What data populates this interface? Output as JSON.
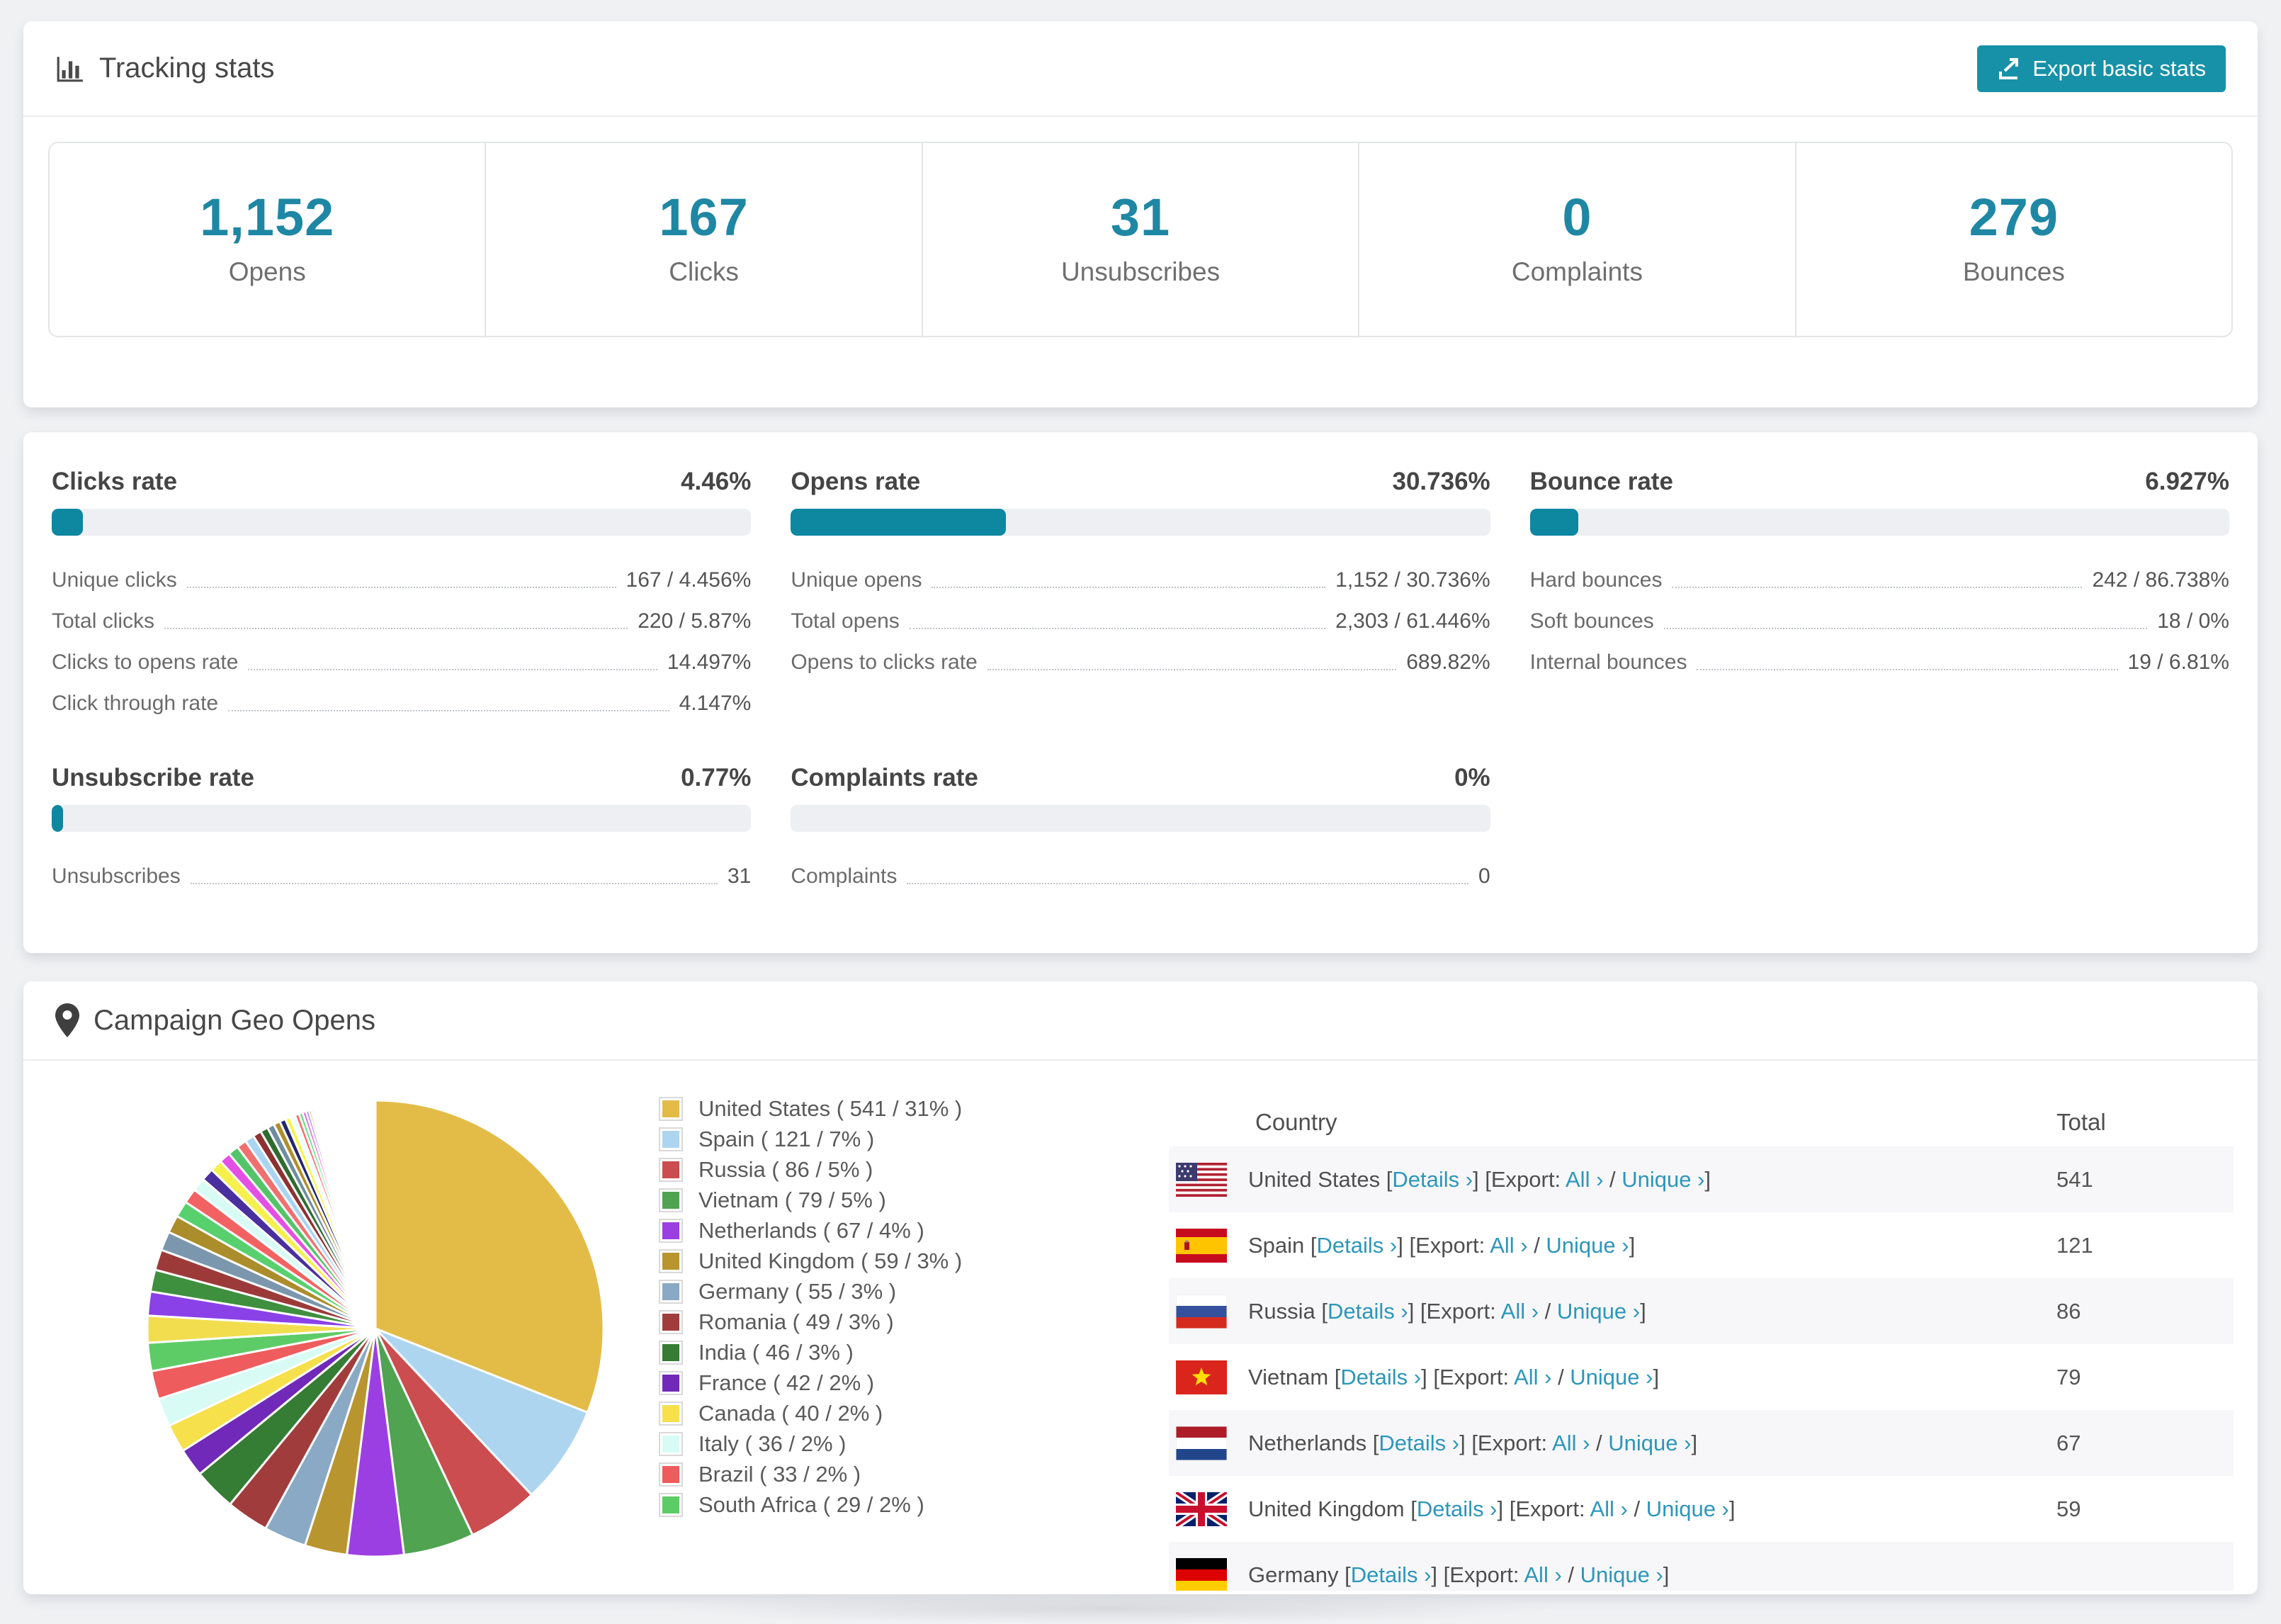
{
  "header": {
    "title": "Tracking stats",
    "export_button": "Export basic stats"
  },
  "summary_stats": [
    {
      "value": "1,152",
      "label": "Opens"
    },
    {
      "value": "167",
      "label": "Clicks"
    },
    {
      "value": "31",
      "label": "Unsubscribes"
    },
    {
      "value": "0",
      "label": "Complaints"
    },
    {
      "value": "279",
      "label": "Bounces"
    }
  ],
  "rate_cards": [
    {
      "title": "Clicks rate",
      "value_label": "4.46%",
      "percent": 4.46,
      "rows": [
        {
          "label": "Unique clicks",
          "value": "167 / 4.456%"
        },
        {
          "label": "Total clicks",
          "value": "220 / 5.87%"
        },
        {
          "label": "Clicks to opens rate",
          "value": "14.497%"
        },
        {
          "label": "Click through rate",
          "value": "4.147%"
        }
      ]
    },
    {
      "title": "Opens rate",
      "value_label": "30.736%",
      "percent": 30.736,
      "rows": [
        {
          "label": "Unique opens",
          "value": "1,152 / 30.736%"
        },
        {
          "label": "Total opens",
          "value": "2,303 / 61.446%"
        },
        {
          "label": "Opens to clicks rate",
          "value": "689.82%"
        }
      ]
    },
    {
      "title": "Bounce rate",
      "value_label": "6.927%",
      "percent": 6.927,
      "rows": [
        {
          "label": "Hard bounces",
          "value": "242 / 86.738%"
        },
        {
          "label": "Soft bounces",
          "value": "18 / 0%"
        },
        {
          "label": "Internal bounces",
          "value": "19 / 6.81%"
        }
      ]
    },
    {
      "title": "Unsubscribe rate",
      "value_label": "0.77%",
      "percent": 0.77,
      "rows": [
        {
          "label": "Unsubscribes",
          "value": "31"
        }
      ]
    },
    {
      "title": "Complaints rate",
      "value_label": "0%",
      "percent": 0,
      "rows": [
        {
          "label": "Complaints",
          "value": "0"
        }
      ]
    }
  ],
  "geo": {
    "title": "Campaign Geo Opens",
    "links": {
      "details": "Details ›",
      "all": "All ›",
      "unique": "Unique ›"
    },
    "row_parts": {
      "p1": " [",
      "p2": "] [Export: ",
      "p3": " / ",
      "p4": "]"
    },
    "table": {
      "columns": [
        "Country",
        "Total"
      ],
      "rows": [
        {
          "flag": "us",
          "country": "United States",
          "total": "541"
        },
        {
          "flag": "es",
          "country": "Spain",
          "total": "121"
        },
        {
          "flag": "ru",
          "country": "Russia",
          "total": "86"
        },
        {
          "flag": "vn",
          "country": "Vietnam",
          "total": "79"
        },
        {
          "flag": "nl",
          "country": "Netherlands",
          "total": "67"
        },
        {
          "flag": "gb",
          "country": "United Kingdom",
          "total": "59"
        },
        {
          "flag": "de",
          "country": "Germany",
          "total": ""
        }
      ]
    }
  },
  "chart_data": {
    "type": "pie",
    "title": "Campaign Geo Opens",
    "legend_position": "right",
    "slices": [
      {
        "name": "United States",
        "value": 541,
        "pct": 31,
        "color": "#e3bc48",
        "label": "United States ( 541 / 31% )"
      },
      {
        "name": "Spain",
        "value": 121,
        "pct": 7,
        "color": "#aed5f0",
        "label": "Spain ( 121 / 7% )"
      },
      {
        "name": "Russia",
        "value": 86,
        "pct": 5,
        "color": "#cb4d4f",
        "label": "Russia ( 86 / 5% )"
      },
      {
        "name": "Vietnam",
        "value": 79,
        "pct": 5,
        "color": "#4fa351",
        "label": "Vietnam ( 79 / 5% )"
      },
      {
        "name": "Netherlands",
        "value": 67,
        "pct": 4,
        "color": "#9b3fe3",
        "label": "Netherlands ( 67 / 4% )"
      },
      {
        "name": "United Kingdom",
        "value": 59,
        "pct": 3,
        "color": "#b9952f",
        "label": "United Kingdom ( 59 / 3% )"
      },
      {
        "name": "Germany",
        "value": 55,
        "pct": 3,
        "color": "#8aa9c4",
        "label": "Germany ( 55 / 3% )"
      },
      {
        "name": "Romania",
        "value": 49,
        "pct": 3,
        "color": "#a03d3c",
        "label": "Romania ( 49 / 3% )"
      },
      {
        "name": "India",
        "value": 46,
        "pct": 3,
        "color": "#357c35",
        "label": "India ( 46 / 3% )"
      },
      {
        "name": "France",
        "value": 42,
        "pct": 2,
        "color": "#7029b8",
        "label": "France ( 42 / 2% )"
      },
      {
        "name": "Canada",
        "value": 40,
        "pct": 2,
        "color": "#f6e04b",
        "label": "Canada ( 40 / 2% )"
      },
      {
        "name": "Italy",
        "value": 36,
        "pct": 2,
        "color": "#d8fbf5",
        "label": "Italy ( 36 / 2% )"
      },
      {
        "name": "Brazil",
        "value": 33,
        "pct": 2,
        "color": "#ef5c5e",
        "label": "Brazil ( 33 / 2% )"
      },
      {
        "name": "South Africa",
        "value": 29,
        "pct": 2,
        "color": "#5ecc66",
        "label": "South Africa ( 29 / 2% )"
      }
    ],
    "other_slices": [
      {
        "pct": 1.9,
        "color": "#f2dd4e"
      },
      {
        "pct": 1.7,
        "color": "#8a41e8"
      },
      {
        "pct": 1.55,
        "color": "#3e8f3e"
      },
      {
        "pct": 1.45,
        "color": "#9c3a3a"
      },
      {
        "pct": 1.35,
        "color": "#7b97ad"
      },
      {
        "pct": 1.25,
        "color": "#ab8d2c"
      },
      {
        "pct": 1.15,
        "color": "#58d06e"
      },
      {
        "pct": 1.05,
        "color": "#f26262"
      },
      {
        "pct": 0.95,
        "color": "#d9fbf6"
      },
      {
        "pct": 0.9,
        "color": "#4a2f9e"
      },
      {
        "pct": 0.85,
        "color": "#f5f04e"
      },
      {
        "pct": 0.8,
        "color": "#e44fe4"
      },
      {
        "pct": 0.75,
        "color": "#54c468"
      },
      {
        "pct": 0.7,
        "color": "#f07070"
      },
      {
        "pct": 0.65,
        "color": "#a9d4f2"
      },
      {
        "pct": 0.6,
        "color": "#8d3131"
      },
      {
        "pct": 0.55,
        "color": "#2f6b2f"
      },
      {
        "pct": 0.5,
        "color": "#6f8da1"
      },
      {
        "pct": 0.46,
        "color": "#b08e2b"
      },
      {
        "pct": 0.42,
        "color": "#26266b"
      },
      {
        "pct": 0.38,
        "color": "#f7f44f"
      },
      {
        "pct": 0.34,
        "color": "#e8fffd"
      },
      {
        "pct": 0.3,
        "color": "#fb6b6b"
      },
      {
        "pct": 0.27,
        "color": "#64e07e"
      },
      {
        "pct": 0.24,
        "color": "#e055e0"
      },
      {
        "pct": 0.21,
        "color": "#a155f0"
      },
      {
        "pct": 0.18,
        "color": "#c2a22f"
      },
      {
        "pct": 0.16,
        "color": "#99c2e8"
      },
      {
        "pct": 0.14,
        "color": "#d43c3c"
      },
      {
        "pct": 0.12,
        "color": "#3fae57"
      },
      {
        "pct": 0.1,
        "color": "#7a2fd0"
      },
      {
        "pct": 0.09,
        "color": "#efe54a"
      },
      {
        "pct": 0.08,
        "color": "#57606e"
      },
      {
        "pct": 0.07,
        "color": "#c94f9e"
      }
    ]
  }
}
